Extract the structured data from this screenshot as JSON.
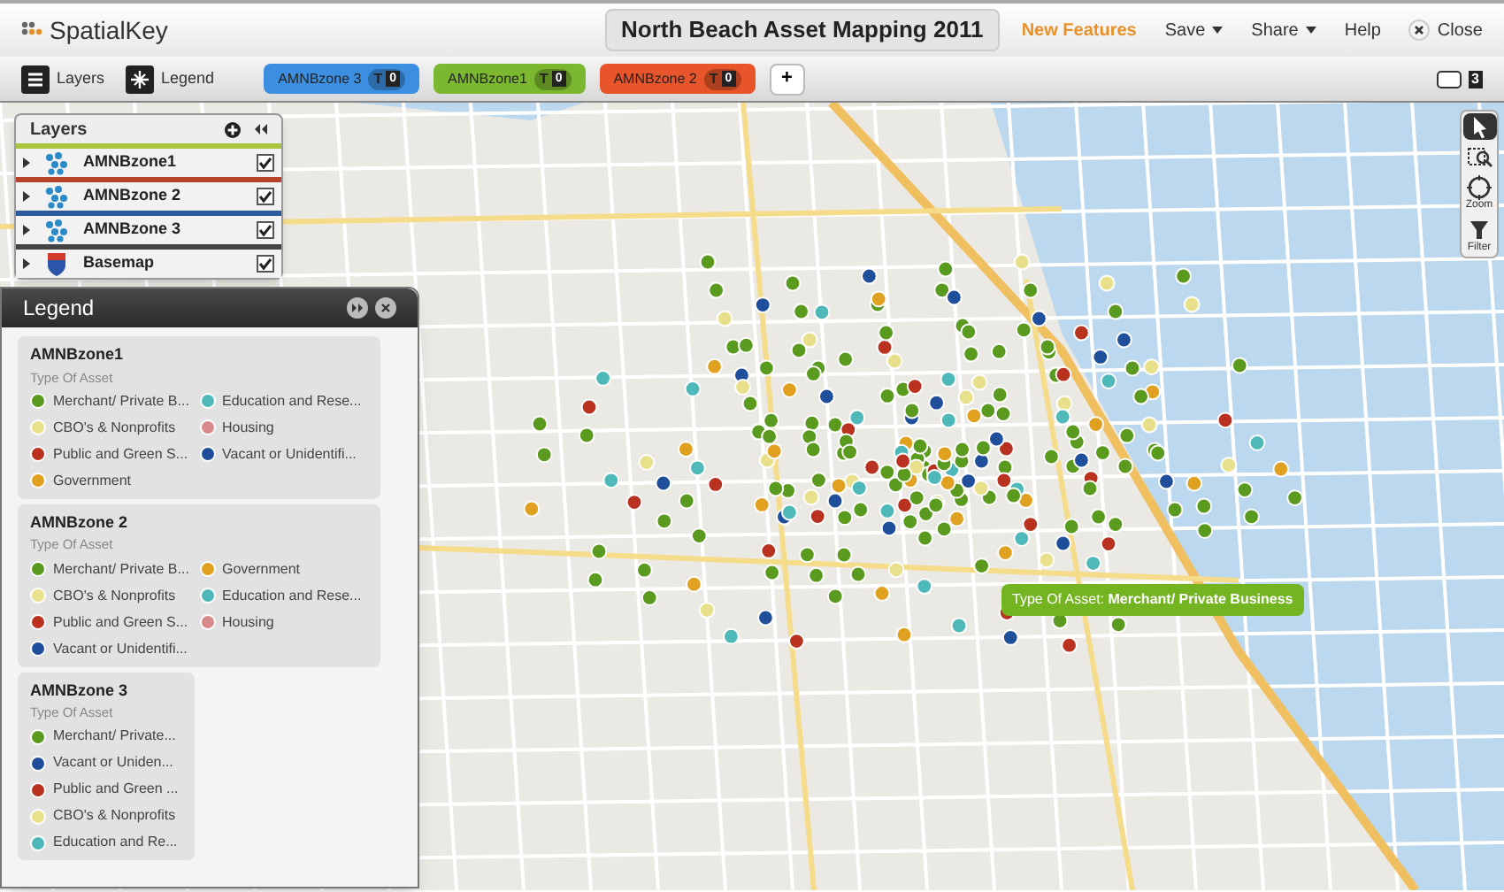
{
  "header": {
    "logo": "SpatialKey",
    "title": "North Beach Asset Mapping 2011",
    "menu": [
      {
        "label": "New Features",
        "kind": "highlight"
      },
      {
        "label": "Save",
        "kind": "dropdown"
      },
      {
        "label": "Share",
        "kind": "dropdown"
      },
      {
        "label": "Help",
        "kind": "plain"
      },
      {
        "label": "Close",
        "kind": "close"
      }
    ]
  },
  "toolbar": {
    "buttons": [
      {
        "label": "Layers",
        "kind": "layers"
      },
      {
        "label": "Legend",
        "kind": "legend"
      }
    ],
    "zone_tabs": [
      {
        "label": "AMNBzone 3",
        "color": "#3b8ee0",
        "filter": "T",
        "count": "0"
      },
      {
        "label": "AMNBzone1",
        "color": "#7cb82f",
        "filter": "T",
        "count": "0"
      },
      {
        "label": "AMNBzone 2",
        "color": "#e8552a",
        "filter": "T",
        "count": "0"
      }
    ],
    "add_button": "+",
    "window_count": "3"
  },
  "layers_panel": {
    "title": "Layers",
    "layers": [
      {
        "name": "AMNBzone1",
        "color": "#a8c43a",
        "kind": "points",
        "checked": true
      },
      {
        "name": "AMNBzone 2",
        "color": "#b8432a",
        "kind": "points",
        "checked": true
      },
      {
        "name": "AMNBzone 3",
        "color": "#2a5a9a",
        "kind": "points",
        "checked": true
      },
      {
        "name": "Basemap",
        "color": "#444444",
        "kind": "basemap",
        "checked": true
      }
    ]
  },
  "legend": {
    "title": "Legend",
    "groups": [
      {
        "title": "AMNBzone1",
        "subtitle": "Type Of Asset",
        "kind": "two-column",
        "items": [
          {
            "label": "Merchant/ Private B...",
            "color": "#5a9a1e"
          },
          {
            "label": "Education and Rese...",
            "color": "#4fb8b8"
          },
          {
            "label": "CBO's & Nonprofits",
            "color": "#e8e08a"
          },
          {
            "label": "Housing",
            "color": "#d88a8a"
          },
          {
            "label": "Public and Green S...",
            "color": "#b8321f"
          },
          {
            "label": "Vacant or Unidentifi...",
            "color": "#1f4f9a"
          },
          {
            "label": "Government",
            "color": "#e0a020"
          }
        ]
      },
      {
        "title": "AMNBzone 2",
        "subtitle": "Type Of Asset",
        "kind": "two-column",
        "items": [
          {
            "label": "Merchant/ Private B...",
            "color": "#5a9a1e"
          },
          {
            "label": "Government",
            "color": "#e0a020"
          },
          {
            "label": "CBO's & Nonprofits",
            "color": "#e8e08a"
          },
          {
            "label": "Education and Rese...",
            "color": "#4fb8b8"
          },
          {
            "label": "Public and Green S...",
            "color": "#b8321f"
          },
          {
            "label": "Housing",
            "color": "#d88a8a"
          },
          {
            "label": "Vacant or Unidentifi...",
            "color": "#1f4f9a"
          }
        ]
      },
      {
        "title": "AMNBzone 3",
        "subtitle": "Type Of Asset",
        "kind": "one-column",
        "items": [
          {
            "label": "Merchant/ Private...",
            "color": "#5a9a1e"
          },
          {
            "label": "Vacant or Uniden...",
            "color": "#1f4f9a"
          },
          {
            "label": "Public and Green ...",
            "color": "#b8321f"
          },
          {
            "label": "CBO's & Nonprofits",
            "color": "#e8e08a"
          },
          {
            "label": "Education and Re...",
            "color": "#4fb8b8"
          }
        ]
      }
    ]
  },
  "tooltip": "Type Of Asset: **Merchant/ Private Business**",
  "map_tools": [
    {
      "kind": "pointer",
      "selected": true
    },
    {
      "kind": "zoom-box",
      "selected": false
    },
    {
      "kind": "zoom",
      "label": "Zoom",
      "selected": false
    },
    {
      "kind": "filter",
      "label": "Filter",
      "selected": false
    }
  ]
}
